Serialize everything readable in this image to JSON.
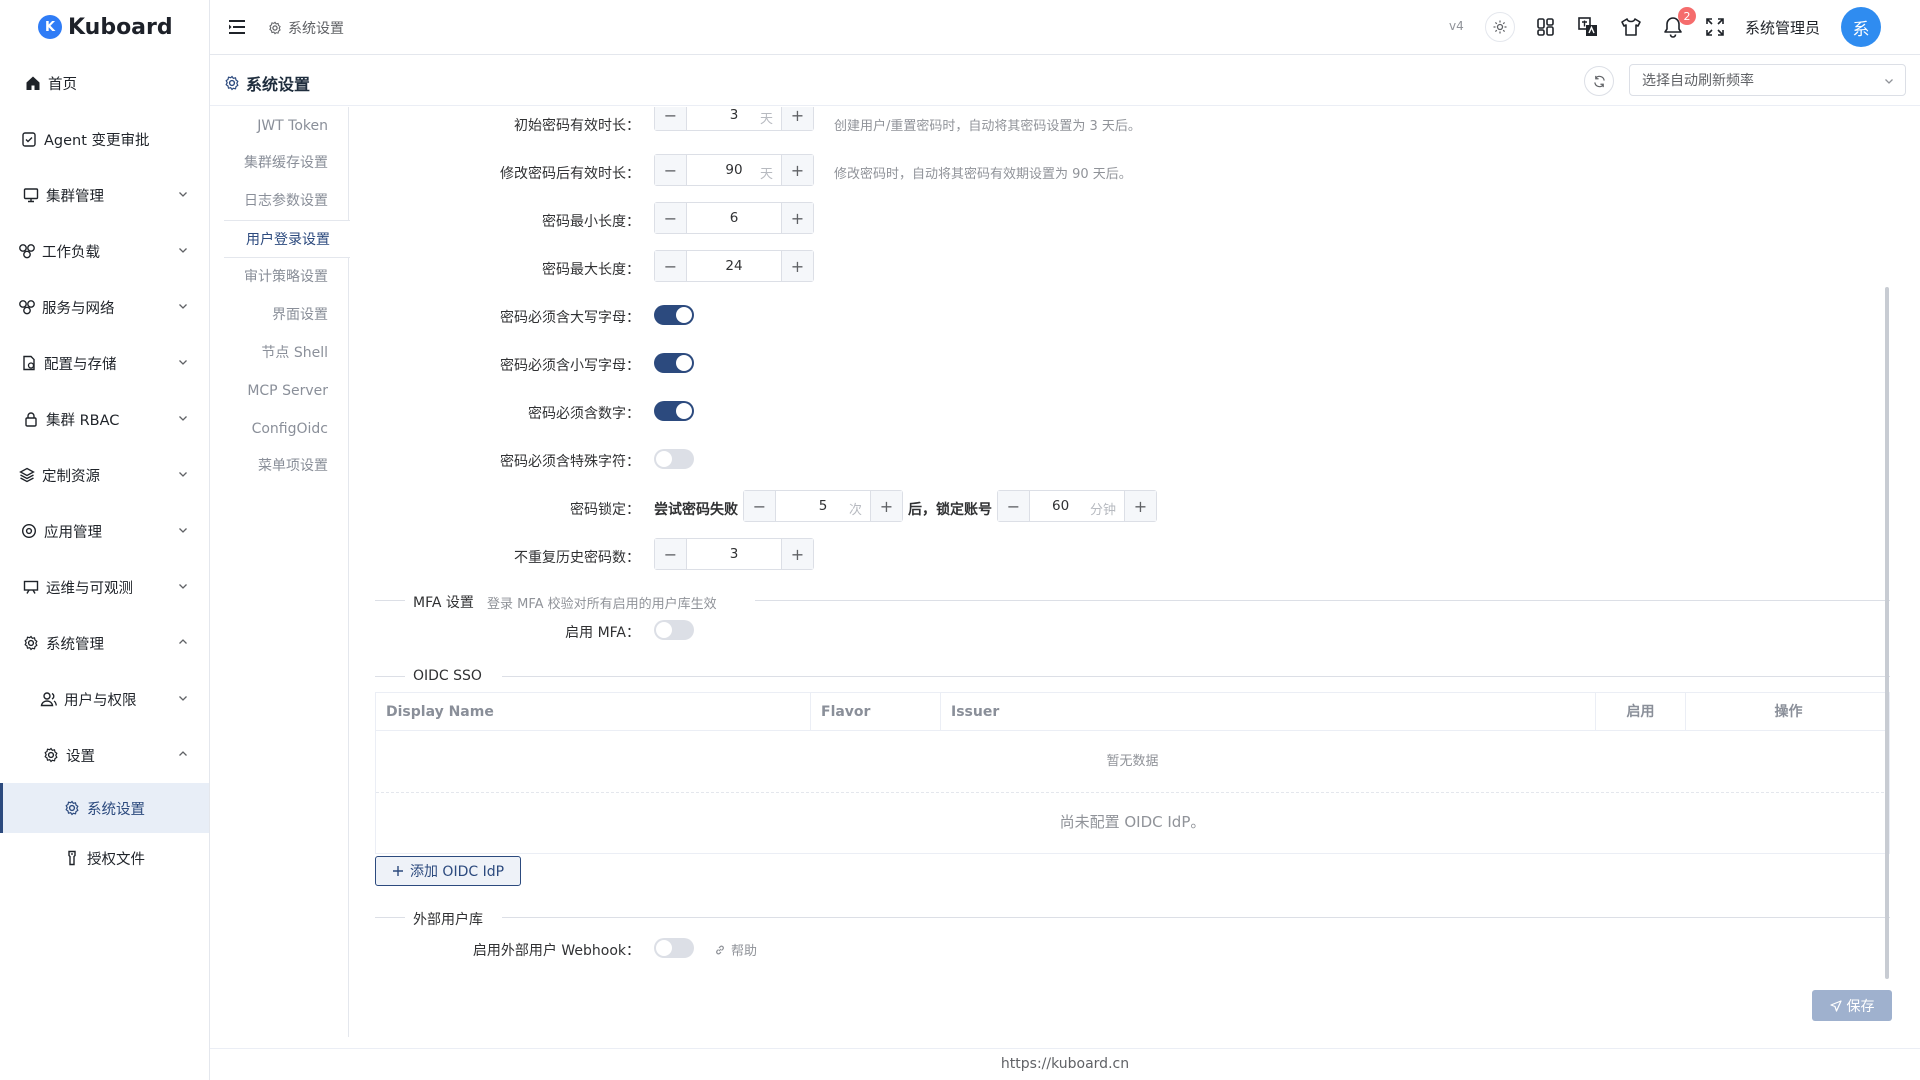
{
  "app": {
    "logo_letter": "K",
    "name": "Kuboard"
  },
  "sidebar": {
    "items": [
      {
        "label": "首页",
        "icon": "home-icon"
      },
      {
        "label": "Agent 变更审批",
        "icon": "approval-icon"
      },
      {
        "label": "集群管理",
        "icon": "monitor-icon"
      },
      {
        "label": "工作负载",
        "icon": "workload-icon"
      },
      {
        "label": "服务与网络",
        "icon": "network-icon"
      },
      {
        "label": "配置与存储",
        "icon": "storage-icon"
      },
      {
        "label": "集群 RBAC",
        "icon": "lock-icon"
      },
      {
        "label": "定制资源",
        "icon": "layers-icon"
      },
      {
        "label": "应用管理",
        "icon": "app-icon"
      },
      {
        "label": "运维与可观测",
        "icon": "observe-icon"
      },
      {
        "label": "系统管理",
        "icon": "gear-icon"
      },
      {
        "label": "用户与权限",
        "icon": "users-icon"
      },
      {
        "label": "设置",
        "icon": "gear-icon"
      },
      {
        "label": "系统设置",
        "icon": "gear-icon"
      },
      {
        "label": "授权文件",
        "icon": "license-icon"
      }
    ]
  },
  "header": {
    "breadcrumb": "系统设置",
    "version": "v4",
    "notification_count": "2",
    "username": "系统管理员",
    "avatar_letter": "系"
  },
  "page": {
    "title": "系统设置",
    "refresh_placeholder": "选择自动刷新频率"
  },
  "tabs": [
    "JWT Token",
    "集群缓存设置",
    "日志参数设置",
    "用户登录设置",
    "审计策略设置",
    "界面设置",
    "节点 Shell",
    "MCP Server",
    "ConfigOidc",
    "菜单项设置"
  ],
  "form": {
    "initial_pwd": {
      "label": "初始密码有效时长：",
      "value": "3",
      "unit": "天",
      "hint": "创建用户/重置密码时，自动将其密码设置为 3 天后。"
    },
    "change_pwd": {
      "label": "修改密码后有效时长：",
      "value": "90",
      "unit": "天",
      "hint": "修改密码时，自动将其密码有效期设置为 90 天后。"
    },
    "min_len": {
      "label": "密码最小长度：",
      "value": "6"
    },
    "max_len": {
      "label": "密码最大长度：",
      "value": "24"
    },
    "upper": {
      "label": "密码必须含大写字母：",
      "enabled": true
    },
    "lower": {
      "label": "密码必须含小写字母：",
      "enabled": true
    },
    "digit": {
      "label": "密码必须含数字：",
      "enabled": true
    },
    "special": {
      "label": "密码必须含特殊字符：",
      "enabled": false
    },
    "lock": {
      "label": "密码锁定：",
      "prefix": "尝试密码失败",
      "attempts": "5",
      "attempts_unit": "次",
      "middle": "后，锁定账号",
      "minutes": "60",
      "minutes_unit": "分钟"
    },
    "history": {
      "label": "不重复历史密码数：",
      "value": "3"
    }
  },
  "mfa": {
    "title": "MFA 设置",
    "subtitle": "登录 MFA 校验对所有启用的用户库生效",
    "label": "启用 MFA：",
    "enabled": false
  },
  "oidc": {
    "title": "OIDC SSO",
    "columns": [
      "Display Name",
      "Flavor",
      "Issuer",
      "启用",
      "操作"
    ],
    "empty_text": "暂无数据",
    "not_configured": "尚未配置 OIDC IdP。",
    "add_button": "添加 OIDC IdP"
  },
  "external": {
    "title": "外部用户库",
    "label": "启用外部用户 Webhook：",
    "enabled": false,
    "help": "帮助"
  },
  "save_button": "保存",
  "footer": "https://kuboard.cn"
}
